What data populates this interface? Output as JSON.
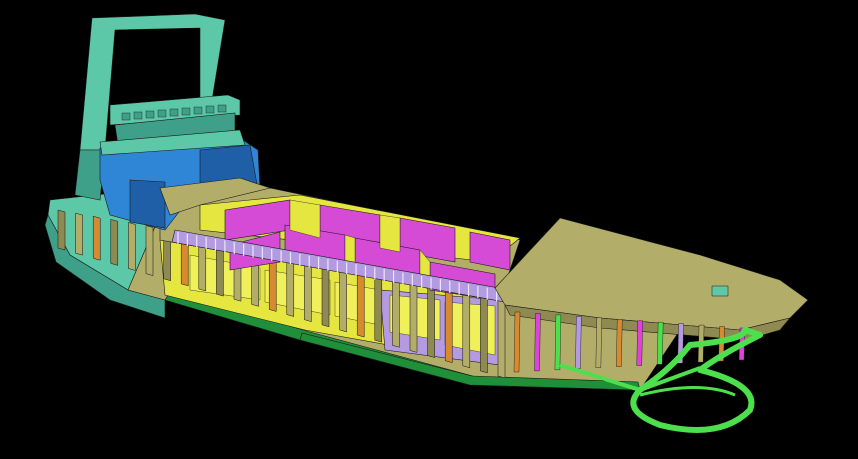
{
  "view": {
    "background": "#000000"
  },
  "colors": {
    "hull_shell": "#b3ad6a",
    "hull_shell_dark": "#8f8a52",
    "superstructure": "#5cc8a8",
    "superstructure_dark": "#3ea088",
    "deckhouse_blue": "#2f86d6",
    "deckhouse_blue_dark": "#1f5fa8",
    "cargo_bulkhead": "#d64bd6",
    "cargo_wall_yellow": "#e6e640",
    "frame_lavender": "#b49ae0",
    "double_bottom_green": "#1f8f3a",
    "bulb_green": "#4ce04c",
    "frame_orange": "#d88a30",
    "frame_pink": "#e040e0",
    "accent_red": "#d84040"
  },
  "model": {
    "components": [
      "mast",
      "wheelhouse",
      "deckhouse",
      "cargo-hold",
      "forecastle-deck",
      "bulbous-bow",
      "side-frames",
      "double-bottom"
    ],
    "cargo_hold_bays": 8,
    "side_frame_count": 26,
    "bow_frame_count": 12
  }
}
